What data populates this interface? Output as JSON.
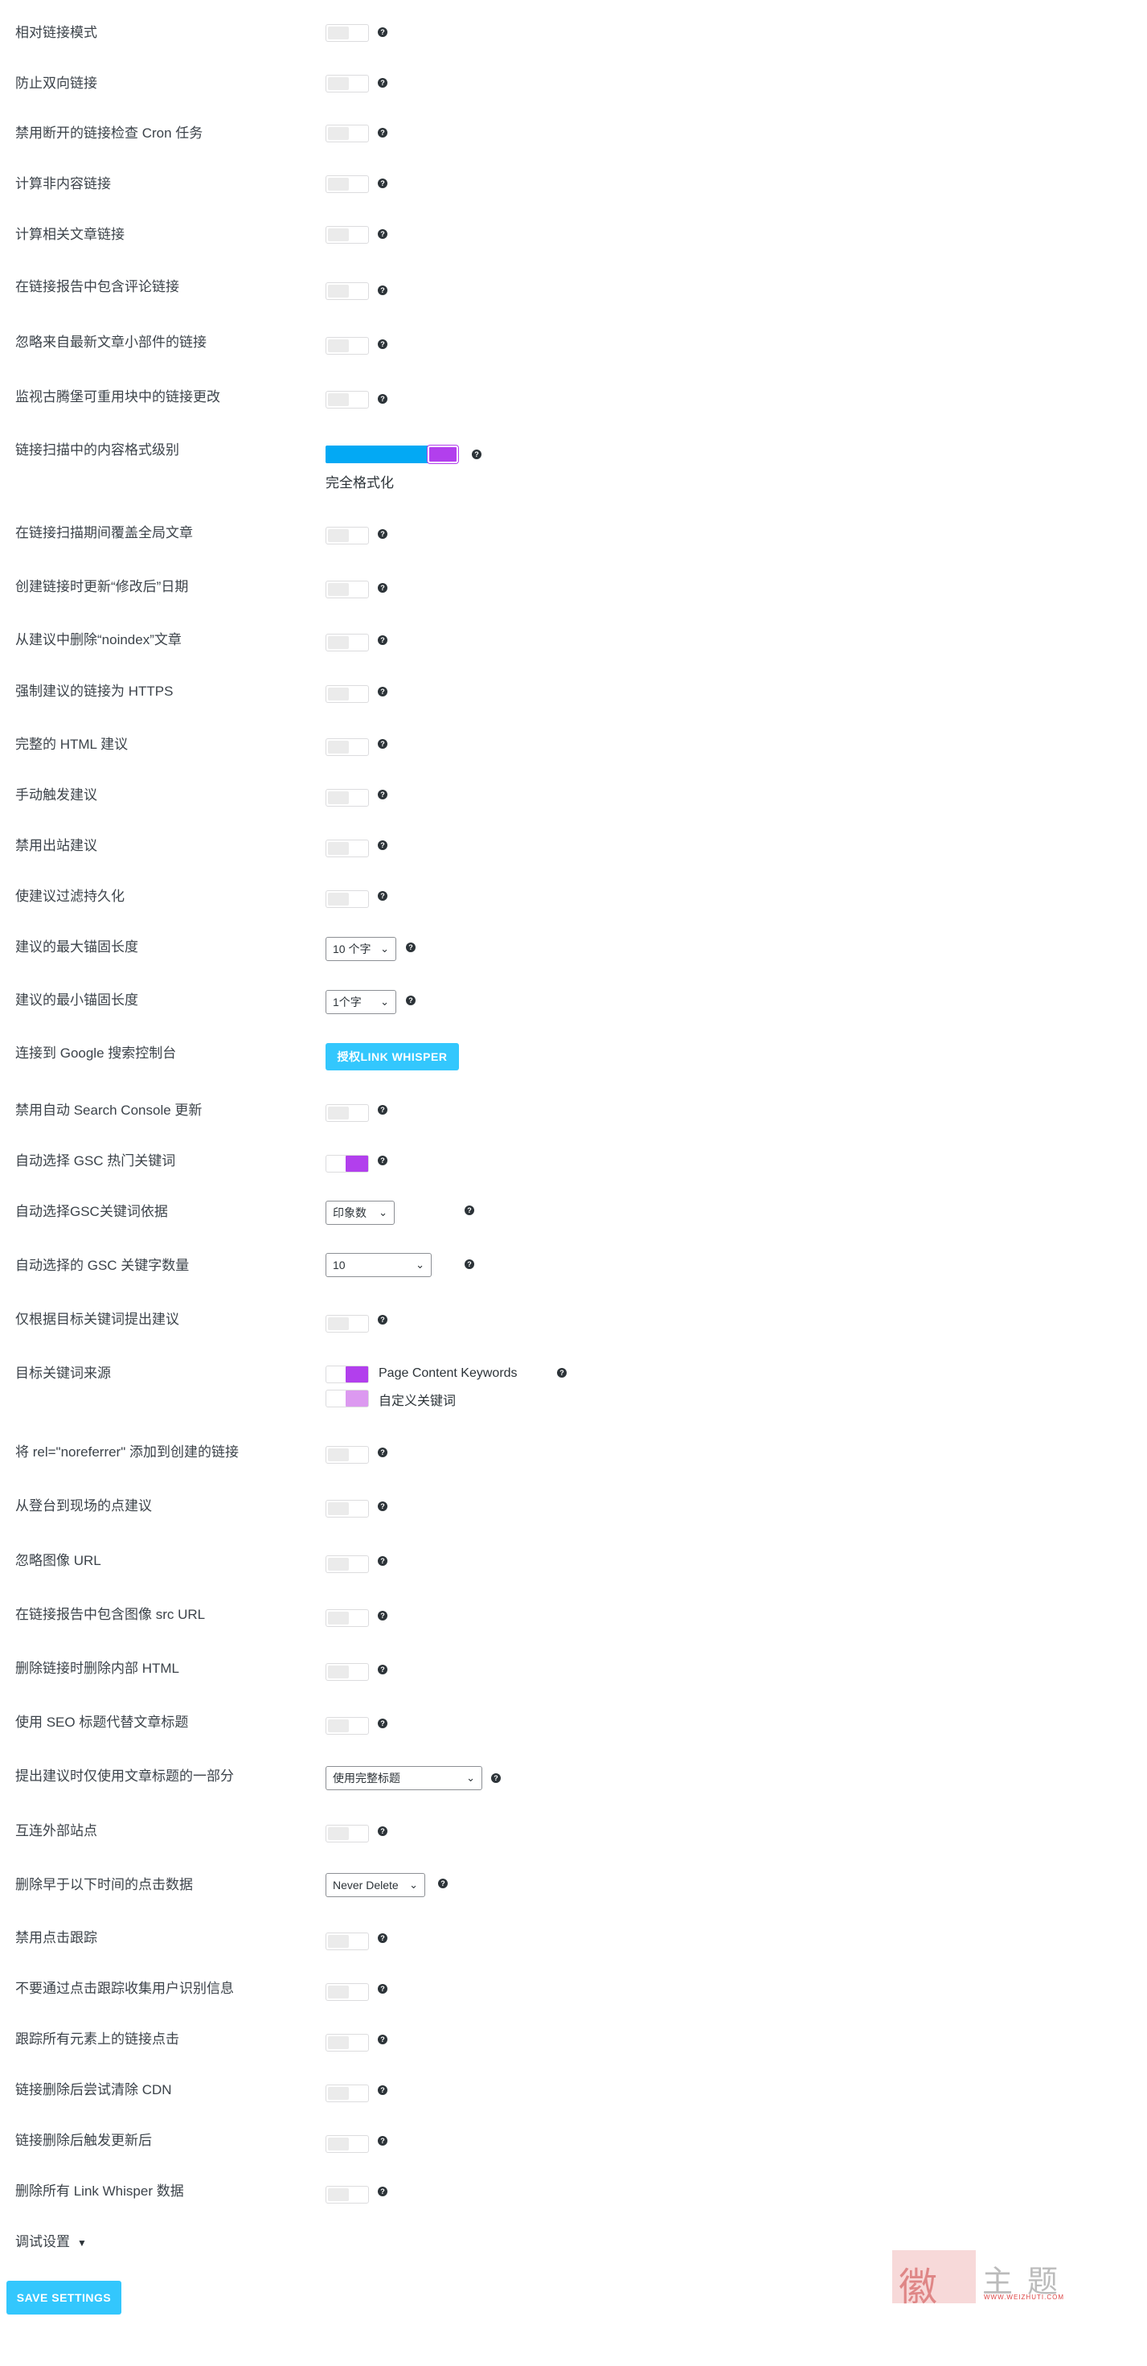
{
  "settings": {
    "r01": "相对链接模式",
    "r02": "防止双向链接",
    "r03": "禁用断开的链接检查 Cron 任务",
    "r04": "计算非内容链接",
    "r05": "计算相关文章链接",
    "r06": "在链接报告中包含评论链接",
    "r07": "忽略来自最新文章小部件的链接",
    "r08": "监视古腾堡可重用块中的链接更改",
    "r09": "链接扫描中的内容格式级别",
    "r09_caption": "完全格式化",
    "r10": "在链接扫描期间覆盖全局文章",
    "r11": "创建链接时更新“修改后”日期",
    "r12": "从建议中删除“noindex”文章",
    "r13": "强制建议的链接为 HTTPS",
    "r14": "完整的 HTML 建议",
    "r15": "手动触发建议",
    "r16": "禁用出站建议",
    "r17": "使建议过滤持久化",
    "r18": "建议的最大锚固长度",
    "r18_value": "10 个字",
    "r19": "建议的最小锚固长度",
    "r19_value": "1个字",
    "r20": "连接到 Google 搜索控制台",
    "r20_button": "授权LINK WHISPER",
    "r21": "禁用自动 Search Console 更新",
    "r22": "自动选择 GSC 热门关键词",
    "r23": "自动选择GSC关键词依据",
    "r23_value": "印象数",
    "r24": "自动选择的 GSC 关键字数量",
    "r24_value": "10",
    "r25": "仅根据目标关键词提出建议",
    "r26": "目标关键词来源",
    "r26_opt1": "Page Content Keywords",
    "r26_opt2": "自定义关键词",
    "r27": "将 rel=\"noreferrer\" 添加到创建的链接",
    "r28": "从登台到现场的点建议",
    "r29": "忽略图像 URL",
    "r30": "在链接报告中包含图像 src URL",
    "r31": "删除链接时删除内部 HTML",
    "r32": "使用 SEO 标题代替文章标题",
    "r33": "提出建议时仅使用文章标题的一部分",
    "r33_value": "使用完整标题",
    "r34": "互连外部站点",
    "r35": "删除早于以下时间的点击数据",
    "r35_value": "Never Delete",
    "r36": "禁用点击跟踪",
    "r37": "不要通过点击跟踪收集用户识别信息",
    "r38": "跟踪所有元素上的链接点击",
    "r39": "链接删除后尝试清除 CDN",
    "r40": "链接删除后触发更新后",
    "r41": "删除所有 Link Whisper 数据"
  },
  "debug": {
    "label": "调试设置",
    "caret": "▼"
  },
  "save_button": "SAVE SETTINGS",
  "help_glyph": "?",
  "chevron": "⌄",
  "watermark": {
    "glyph": "徽",
    "text": "主题",
    "small": "WWW.WEIZHUTI.COM"
  },
  "colors": {
    "accent_purple": "#b23fed",
    "accent_blue": "#33c7fd",
    "slider_blue": "#03a9f4"
  }
}
